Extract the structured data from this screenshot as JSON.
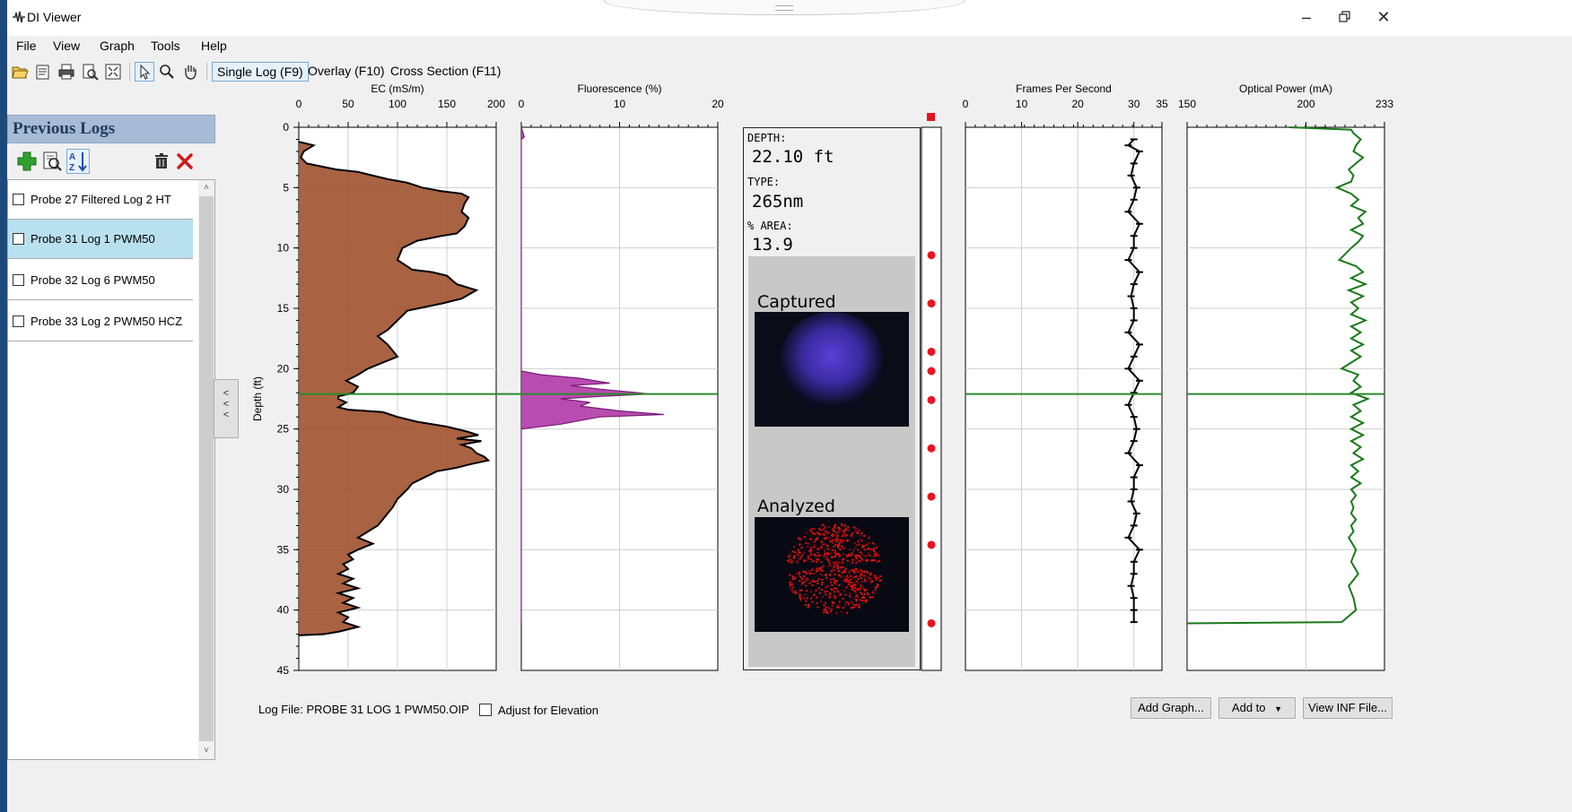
{
  "window": {
    "title": "DI Viewer"
  },
  "menu": [
    "File",
    "View",
    "Graph",
    "Tools",
    "Help"
  ],
  "toolbar": {
    "icons": [
      "open-folder-icon",
      "properties-icon",
      "print-icon",
      "print-preview-icon",
      "fit-window-icon",
      "pointer-icon",
      "zoom-icon",
      "pan-hand-icon"
    ],
    "modes": [
      "Single Log (F9)",
      "Overlay (F10)",
      "Cross Section (F11)"
    ],
    "active_mode": "Single Log (F9)"
  },
  "sidebar": {
    "title": "Previous Logs",
    "logs": [
      {
        "label": "Probe 27 Filtered Log 2 HT",
        "selected": false
      },
      {
        "label": "Probe 31 Log 1 PWM50",
        "selected": true
      },
      {
        "label": "Probe 32 Log 6 PWM50",
        "selected": false
      },
      {
        "label": "Probe 33 Log 2 PWM50 HCZ",
        "selected": false
      }
    ]
  },
  "collapse_label": "<<<",
  "chart_data": {
    "type": "line",
    "depth_axis": {
      "label": "Depth (ft)",
      "range": [
        0,
        45
      ],
      "ticks": [
        0,
        5,
        10,
        15,
        20,
        25,
        30,
        35,
        40,
        45
      ],
      "inverted": true
    },
    "marker_depth": 22.1,
    "tracks": [
      {
        "name": "EC (mS/m)",
        "xlim": [
          0,
          200
        ],
        "ticks": [
          0,
          50,
          100,
          150,
          200
        ],
        "style": "filled",
        "fill": "#a0522d",
        "points": [
          [
            0,
            1.2
          ],
          [
            15,
            1.5
          ],
          [
            5,
            2.0
          ],
          [
            2,
            2.5
          ],
          [
            8,
            3.0
          ],
          [
            38,
            3.5
          ],
          [
            60,
            3.7
          ],
          [
            75,
            4.0
          ],
          [
            90,
            4.3
          ],
          [
            110,
            4.6
          ],
          [
            125,
            5.0
          ],
          [
            145,
            5.3
          ],
          [
            165,
            5.5
          ],
          [
            172,
            5.8
          ],
          [
            168,
            6.3
          ],
          [
            165,
            7.0
          ],
          [
            172,
            7.5
          ],
          [
            168,
            8.2
          ],
          [
            160,
            8.8
          ],
          [
            145,
            9.0
          ],
          [
            120,
            9.4
          ],
          [
            105,
            10.0
          ],
          [
            100,
            11.0
          ],
          [
            115,
            11.8
          ],
          [
            135,
            12.0
          ],
          [
            150,
            12.3
          ],
          [
            160,
            13.0
          ],
          [
            180,
            13.5
          ],
          [
            165,
            14.2
          ],
          [
            145,
            14.6
          ],
          [
            110,
            15.2
          ],
          [
            100,
            16.0
          ],
          [
            90,
            16.8
          ],
          [
            80,
            17.3
          ],
          [
            90,
            18.0
          ],
          [
            95,
            18.5
          ],
          [
            100,
            19.0
          ],
          [
            82,
            19.6
          ],
          [
            70,
            20.0
          ],
          [
            60,
            20.5
          ],
          [
            48,
            21.0
          ],
          [
            60,
            21.5
          ],
          [
            55,
            22.0
          ],
          [
            40,
            22.3
          ],
          [
            40,
            22.5
          ],
          [
            48,
            22.8
          ],
          [
            40,
            23.2
          ],
          [
            50,
            23.4
          ],
          [
            85,
            23.6
          ],
          [
            100,
            24.0
          ],
          [
            120,
            24.4
          ],
          [
            150,
            24.8
          ],
          [
            170,
            25.2
          ],
          [
            182,
            25.5
          ],
          [
            160,
            25.8
          ],
          [
            185,
            26.0
          ],
          [
            165,
            26.3
          ],
          [
            175,
            26.6
          ],
          [
            180,
            27.0
          ],
          [
            188,
            27.3
          ],
          [
            192,
            27.6
          ],
          [
            175,
            27.9
          ],
          [
            160,
            28.2
          ],
          [
            140,
            28.5
          ],
          [
            130,
            28.9
          ],
          [
            115,
            29.5
          ],
          [
            110,
            30.0
          ],
          [
            100,
            30.8
          ],
          [
            95,
            31.5
          ],
          [
            90,
            32.0
          ],
          [
            85,
            32.5
          ],
          [
            80,
            33.0
          ],
          [
            70,
            33.5
          ],
          [
            60,
            34.0
          ],
          [
            75,
            34.5
          ],
          [
            60,
            35.0
          ],
          [
            50,
            35.4
          ],
          [
            55,
            35.8
          ],
          [
            45,
            36.2
          ],
          [
            50,
            36.6
          ],
          [
            40,
            37.0
          ],
          [
            55,
            37.4
          ],
          [
            45,
            37.8
          ],
          [
            60,
            38.2
          ],
          [
            40,
            38.6
          ],
          [
            55,
            39.0
          ],
          [
            45,
            39.4
          ],
          [
            60,
            39.8
          ],
          [
            40,
            40.2
          ],
          [
            50,
            40.6
          ],
          [
            45,
            41.0
          ],
          [
            60,
            41.4
          ],
          [
            40,
            41.8
          ],
          [
            25,
            42.0
          ],
          [
            0,
            42.1
          ]
        ]
      },
      {
        "name": "Fluorescence (%)",
        "xlim": [
          0,
          20
        ],
        "ticks": [
          0,
          10,
          20
        ],
        "style": "filled",
        "fill": "#b03aa8",
        "points": [
          [
            0,
            0
          ],
          [
            0.3,
            0.8
          ],
          [
            0,
            1.0
          ],
          [
            0,
            20.2
          ],
          [
            2,
            20.5
          ],
          [
            6,
            20.8
          ],
          [
            9,
            21.2
          ],
          [
            5,
            21.4
          ],
          [
            8,
            21.7
          ],
          [
            12,
            22.0
          ],
          [
            13,
            22.1
          ],
          [
            8,
            22.3
          ],
          [
            4,
            22.5
          ],
          [
            7,
            22.8
          ],
          [
            6,
            23.1
          ],
          [
            10,
            23.5
          ],
          [
            14.5,
            23.8
          ],
          [
            8,
            24.0
          ],
          [
            6,
            24.3
          ],
          [
            4,
            24.6
          ],
          [
            0,
            25.0
          ],
          [
            0,
            41.0
          ]
        ]
      },
      {
        "name": "Frames Per Second",
        "xlim": [
          0,
          35
        ],
        "ticks": [
          0,
          10,
          20,
          30,
          35
        ],
        "style": "line",
        "color": "#000000",
        "points": [
          [
            30,
            1.0
          ],
          [
            29,
            1.5
          ],
          [
            31,
            2.0
          ],
          [
            30,
            3.0
          ],
          [
            29.5,
            4.0
          ],
          [
            30.5,
            5.0
          ],
          [
            30,
            6.0
          ],
          [
            29,
            7.0
          ],
          [
            31,
            8.0
          ],
          [
            30,
            9.0
          ],
          [
            30,
            10.0
          ],
          [
            29,
            11.0
          ],
          [
            31,
            12.0
          ],
          [
            30,
            13.0
          ],
          [
            29.5,
            14.0
          ],
          [
            30,
            15.0
          ],
          [
            30,
            16.0
          ],
          [
            29,
            17.0
          ],
          [
            31,
            18.0
          ],
          [
            30,
            19.0
          ],
          [
            29,
            20.0
          ],
          [
            31,
            21.0
          ],
          [
            30,
            22.0
          ],
          [
            29,
            23.0
          ],
          [
            30,
            24.0
          ],
          [
            30.5,
            25.0
          ],
          [
            30,
            26.0
          ],
          [
            29,
            27.0
          ],
          [
            31,
            28.0
          ],
          [
            30,
            29.0
          ],
          [
            30,
            30.0
          ],
          [
            29.5,
            31.0
          ],
          [
            30.5,
            32.0
          ],
          [
            30,
            33.0
          ],
          [
            29,
            34.0
          ],
          [
            31,
            35.0
          ],
          [
            30,
            36.0
          ],
          [
            30,
            37.0
          ],
          [
            29.5,
            38.0
          ],
          [
            30,
            39.0
          ],
          [
            30,
            40.0
          ],
          [
            30,
            41.0
          ]
        ]
      },
      {
        "name": "Optical Power (mA)",
        "xlim": [
          150,
          233
        ],
        "ticks": [
          150,
          200,
          233
        ],
        "style": "line",
        "color": "#1a7a1a",
        "points": [
          [
            193,
            0
          ],
          [
            219,
            0.2
          ],
          [
            220,
            0.5
          ],
          [
            223,
            1.0
          ],
          [
            221,
            1.5
          ],
          [
            220,
            2.0
          ],
          [
            224,
            2.5
          ],
          [
            221,
            3.0
          ],
          [
            218,
            3.5
          ],
          [
            220,
            4.0
          ],
          [
            219,
            4.5
          ],
          [
            213,
            5.0
          ],
          [
            219,
            5.5
          ],
          [
            222,
            6.0
          ],
          [
            219,
            6.5
          ],
          [
            225,
            7.0
          ],
          [
            222,
            7.5
          ],
          [
            224,
            8.0
          ],
          [
            219,
            8.5
          ],
          [
            224,
            9.0
          ],
          [
            222,
            9.5
          ],
          [
            219,
            10.0
          ],
          [
            214,
            11.0
          ],
          [
            221,
            11.5
          ],
          [
            224,
            12.0
          ],
          [
            219,
            12.5
          ],
          [
            225,
            13.0
          ],
          [
            218,
            13.5
          ],
          [
            224,
            14.0
          ],
          [
            219,
            14.5
          ],
          [
            222,
            15.0
          ],
          [
            219,
            15.5
          ],
          [
            225,
            16.0
          ],
          [
            219,
            16.5
          ],
          [
            223,
            17.0
          ],
          [
            219,
            17.5
          ],
          [
            224,
            18.0
          ],
          [
            219,
            18.5
          ],
          [
            223,
            19.0
          ],
          [
            219,
            19.5
          ],
          [
            215,
            20.0
          ],
          [
            222,
            20.5
          ],
          [
            220,
            21.0
          ],
          [
            223,
            21.5
          ],
          [
            219,
            22.0
          ],
          [
            226,
            22.5
          ],
          [
            220,
            23.0
          ],
          [
            223,
            23.5
          ],
          [
            219,
            24.0
          ],
          [
            224,
            24.5
          ],
          [
            219,
            25.0
          ],
          [
            224,
            25.5
          ],
          [
            219,
            26.0
          ],
          [
            223,
            26.5
          ],
          [
            220,
            27.0
          ],
          [
            224,
            27.5
          ],
          [
            219,
            28.0
          ],
          [
            222,
            28.5
          ],
          [
            219,
            29.0
          ],
          [
            223,
            29.5
          ],
          [
            219,
            30.0
          ],
          [
            221,
            30.5
          ],
          [
            219,
            31.0
          ],
          [
            220,
            31.5
          ],
          [
            219,
            32.0
          ],
          [
            221,
            32.5
          ],
          [
            219,
            33.0
          ],
          [
            220,
            33.5
          ],
          [
            218,
            34.0
          ],
          [
            221,
            35.0
          ],
          [
            219,
            36.0
          ],
          [
            222,
            37.0
          ],
          [
            218,
            38.0
          ],
          [
            220,
            39.0
          ],
          [
            221,
            40.0
          ],
          [
            215,
            41.0
          ],
          [
            150,
            41.1
          ]
        ]
      }
    ],
    "image_panel": {
      "depth_label": "DEPTH:",
      "depth_value": "22.10 ft",
      "type_label": "TYPE:",
      "type_value": "265nm",
      "area_label": "% AREA:",
      "area_value": "13.9",
      "captured_label": "Captured",
      "analyzed_label": "Analyzed"
    },
    "image_markers_depth": [
      10.6,
      14.6,
      18.6,
      20.2,
      22.6,
      26.6,
      30.6,
      34.6,
      41.1
    ]
  },
  "status": {
    "log_file": "Log File: PROBE 31 LOG 1 PWM50.OIP",
    "adjust_label": "Adjust for Elevation",
    "adjust_checked": false
  },
  "buttons": {
    "add_graph": "Add Graph...",
    "add_to": "Add to",
    "view_inf": "View INF File..."
  },
  "colors": {
    "selected_row": "#b9e0ee",
    "marker_line": "#2a8a2a",
    "marker_dot": "#e8141e"
  }
}
